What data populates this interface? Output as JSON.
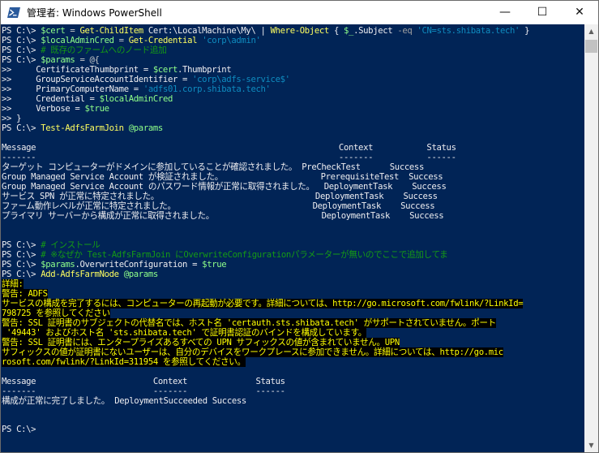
{
  "window": {
    "title": "管理者: Windows PowerShell",
    "minimize": "—",
    "maximize": "☐",
    "close": "✕"
  },
  "console": {
    "l1": {
      "p": "PS C:\\> ",
      "v1": "$cert",
      "o1": " = ",
      "c1": "Get-ChildItem",
      "a1": " Cert:\\LocalMachine\\My\\ | ",
      "c2": "Where-Object",
      "a2": " { ",
      "v2": "$_",
      "a3": ".Subject ",
      "p2": "-eq",
      "a4": " ",
      "s1": "'CN=sts.shibata.tech'",
      "a5": " }"
    },
    "l2": {
      "p": "PS C:\\> ",
      "v1": "$localAdminCred",
      "o1": " = ",
      "c1": "Get-Credential",
      "a1": " ",
      "s1": "'corp\\admin'"
    },
    "l3": {
      "p": "PS C:\\> ",
      "cm": "# 既存のファームへのノード追加"
    },
    "l4": {
      "p": "PS C:\\> ",
      "v1": "$params",
      "o1": " = @{"
    },
    "l5": {
      "p": ">>     ",
      "a1": "CertificateThumbprint = ",
      "v1": "$cert",
      "a2": ".Thumbprint"
    },
    "l6": {
      "p": ">>     ",
      "a1": "GroupServiceAccountIdentifier = ",
      "s1": "'corp\\adfs-service$'"
    },
    "l7": {
      "p": ">>     ",
      "a1": "PrimaryComputerName = ",
      "s1": "'adfs01.corp.shibata.tech'"
    },
    "l8": {
      "p": ">>     ",
      "a1": "Credential = ",
      "v1": "$localAdminCred"
    },
    "l9": {
      "p": ">>     ",
      "a1": "Verbose = ",
      "v1": "$true"
    },
    "l10": {
      "p": ">> }"
    },
    "l11": {
      "p": "PS C:\\> ",
      "c1": "Test-AdfsFarmJoin",
      "a1": " ",
      "v1": "@params"
    },
    "t1": {
      "hdr": "Message                                                              Context           Status",
      "sep": "-------                                                              -------           ------",
      "rows": [
        "ターゲット コンピューターがドメインに参加していることが確認されました。 PreCheckTest      Success",
        "Group Managed Service Account が検証されました。                    PrerequisiteTest  Success",
        "Group Managed Service Account のパスワード情報が正常に取得されました。  DeploymentTask    Success",
        "サービス SPN が正常に特定されました。                                DeploymentTask    Success",
        "ファーム動作レベルが正常に特定されました。                            DeploymentTask    Success",
        "プライマリ サーバーから構成が正常に取得されました。                      DeploymentTask    Success"
      ]
    },
    "l12": {
      "p": "PS C:\\> ",
      "cm": "# インストール"
    },
    "l13": {
      "p": "PS C:\\> ",
      "cm": "# ※なぜか Test-AdfsFarmJoin にOverwriteConfigurationパラメーターが無いのでここで追加してま"
    },
    "l14": {
      "p": "PS C:\\> ",
      "v1": "$params",
      "a1": ".OverwriteConfiguration = ",
      "v2": "$true"
    },
    "l15": {
      "p": "PS C:\\> ",
      "c1": "Add-AdfsFarmNode",
      "a1": " ",
      "v1": "@params"
    },
    "verbose": [
      "詳細:",
      "警告: ADFS",
      "サービスの構成を完了するには、コンピューターの再起動が必要です。詳細については、http://go.microsoft.com/fwlink/?LinkId=",
      "798725 を参照してください",
      "警告: SSL 証明書のサブジェクトの代替名では、ホスト名 'certauth.sts.shibata.tech' がサポートされていません。ポート",
      " '49443' およびホスト名 'sts.shibata.tech' で証明書認証のバインドを構成しています。",
      "警告: SSL 証明書には、エンタープライズあるすべての UPN サフィックスの値が含まれていません。UPN",
      "サフィックスの値が証明書にないユーザーは、自分のデバイスをワークプレースに参加できません。詳細については、http://go.mic",
      "rosoft.com/fwlink/?LinkId=311954 を参照してください。"
    ],
    "t2": {
      "hdr": "Message                        Context              Status",
      "sep": "-------                        -------              ------",
      "row": "構成が正常に完了しました。 DeploymentSucceeded Success"
    },
    "last": "PS C:\\> "
  },
  "scrollbar": {
    "up": "▲",
    "down": "▼"
  }
}
